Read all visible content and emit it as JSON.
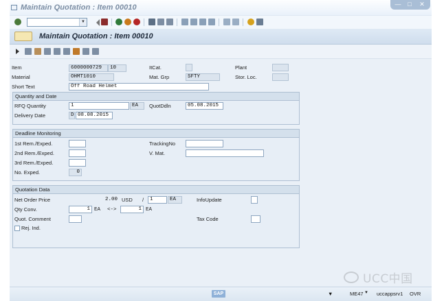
{
  "window": {
    "title": "Maintain Quotation : Item 00010"
  },
  "screen": {
    "title": "Maintain Quotation : Item 00010"
  },
  "item": {
    "item_label": "Item",
    "item_number": "6000000729",
    "item_pos": "10",
    "itcat_label": "ItCat.",
    "itcat_value": "",
    "plant_label": "Plant",
    "plant_value": "",
    "material_label": "Material",
    "material_value": "OHMT1010",
    "matgrp_label": "Mat. Grp",
    "matgrp_value": "SFTY",
    "storloc_label": "Stor. Loc.",
    "storloc_value": "",
    "shorttext_label": "Short Text",
    "shorttext_value": "Off Road Helmet"
  },
  "quantity_date": {
    "header": "Quantity and Date",
    "rfq_qty_label": "RFQ Quantity",
    "rfq_qty_value": "1",
    "rfq_unit": "EA",
    "quotddln_label": "QuotDdln",
    "quotddln_value": "05.08.2015",
    "delivery_label": "Delivery Date",
    "delivery_cat": "D",
    "delivery_value": "08.08.2015"
  },
  "deadline": {
    "header": "Deadline Monitoring",
    "rem1_label": "1st Rem./Exped.",
    "rem2_label": "2nd Rem./Exped.",
    "rem3_label": "3rd Rem./Exped.",
    "noexped_label": "No. Exped.",
    "noexped_value": "0",
    "tracking_label": "TrackingNo",
    "tracking_value": "",
    "vmat_label": "V. Mat.",
    "vmat_value": ""
  },
  "quotation": {
    "header": "Quotation Data",
    "netprice_label": "Net Order Price",
    "netprice_value": "2.00",
    "currency": "USD",
    "per_sep": "/",
    "per_value": "1",
    "per_unit": "EA",
    "infoupdate_label": "InfoUpdate",
    "qtyconv_label": "Qty Conv.",
    "qtyconv_left": "1",
    "qtyconv_left_unit": "EA",
    "qtyconv_arrow": "<->",
    "qtyconv_right": "1",
    "qtyconv_right_unit": "EA",
    "comment_label": "Quot. Comment",
    "taxcode_label": "Tax Code",
    "rejind_label": "Rej. Ind."
  },
  "status": {
    "sap_logo": "SAP",
    "tcode": "ME47",
    "server": "uccappsrv1",
    "mode": "OVR"
  },
  "watermark": "UCC中国",
  "colors": {
    "accent": "#1f2a3a",
    "field_border": "#8ea6c0",
    "group_bg": "#e7eef6"
  }
}
